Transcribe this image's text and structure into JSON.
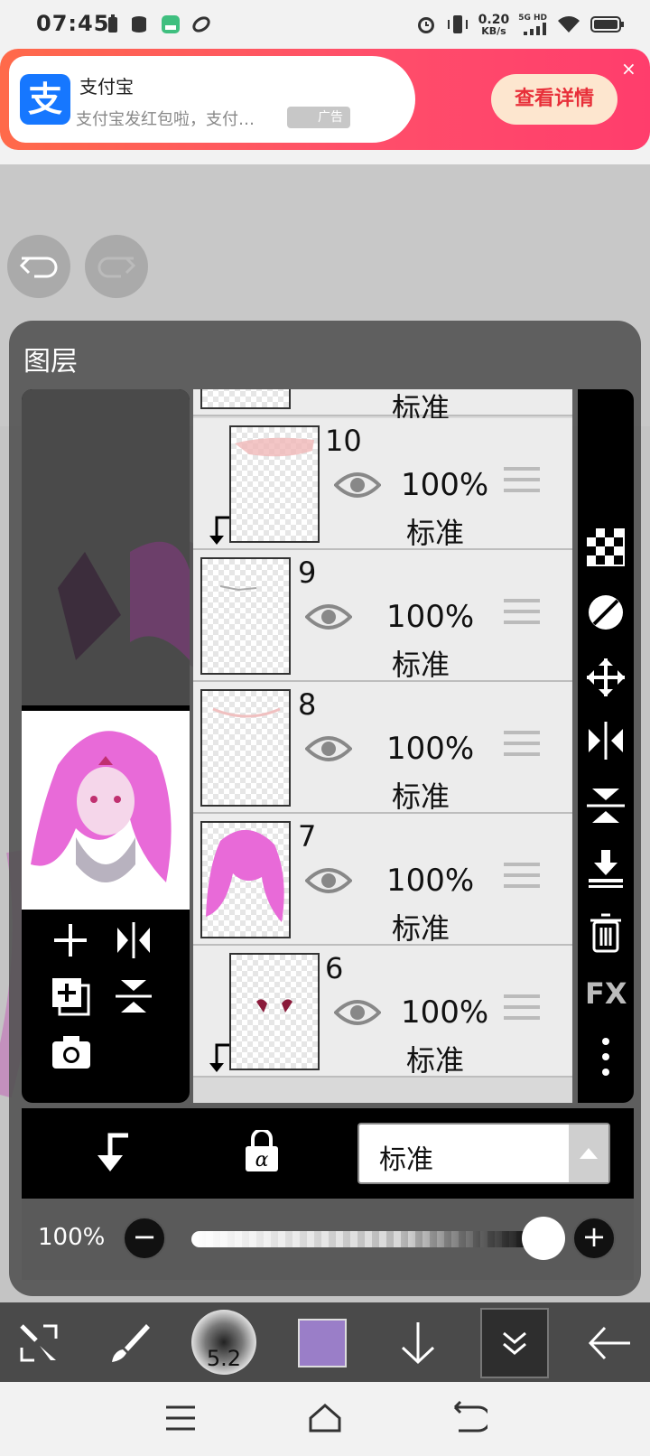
{
  "status_bar": {
    "time": "07:45",
    "net_speed_value": "0.20",
    "net_speed_unit": "KB/s",
    "signal_label": "5G HD"
  },
  "ad": {
    "app_name": "支付宝",
    "logo_char": "支",
    "subtitle": "支付宝发红包啦，支付…",
    "tag": "广告",
    "cta": "查看详情",
    "close": "×"
  },
  "panel": {
    "title": "图层",
    "top_partial_mode": "标准",
    "layers": [
      {
        "number": "10",
        "opacity": "100%",
        "mode": "标准",
        "clipped": true
      },
      {
        "number": "9",
        "opacity": "100%",
        "mode": "标准",
        "clipped": false
      },
      {
        "number": "8",
        "opacity": "100%",
        "mode": "标准",
        "clipped": false
      },
      {
        "number": "7",
        "opacity": "100%",
        "mode": "标准",
        "clipped": false
      },
      {
        "number": "6",
        "opacity": "100%",
        "mode": "标准",
        "clipped": true
      }
    ],
    "side_fx_label": "FX",
    "blend_mode": "标准",
    "opacity_label": "100%",
    "opacity_value": 1.0
  },
  "toolbar": {
    "brush_size": "5.2",
    "color": "#9a7ec8"
  },
  "colors": {
    "ad_gradient_start": "#ff6a4a",
    "ad_gradient_end": "#ff3d6c",
    "alipay_blue": "#1677ff",
    "cta_text": "#e8303a",
    "hair_pink": "#e86ad8"
  }
}
